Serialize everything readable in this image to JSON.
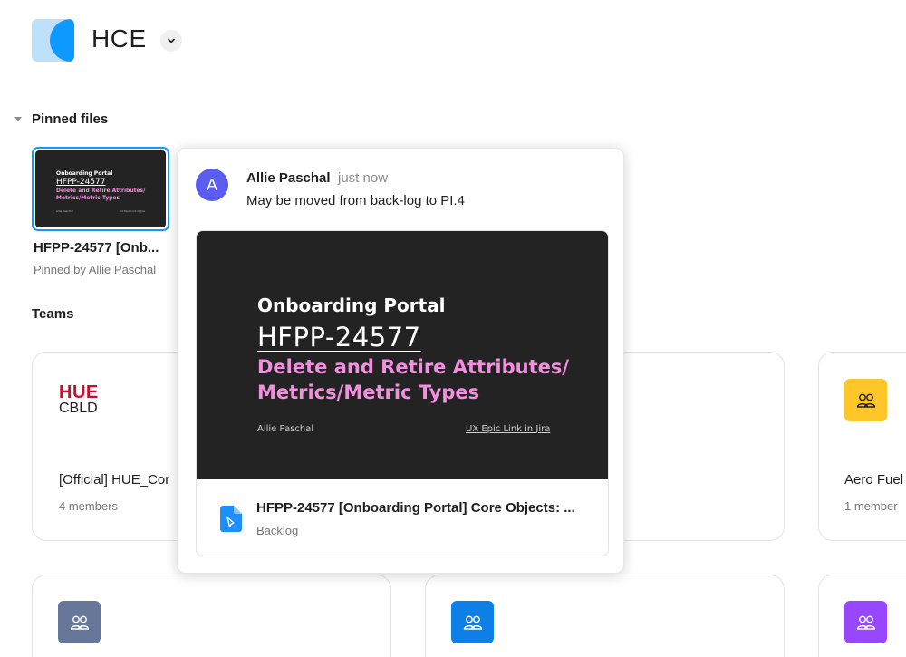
{
  "org": {
    "name": "HCE"
  },
  "pinned": {
    "section_title": "Pinned files",
    "file_name": "HFPP-24577 [Onb...",
    "pinned_by": "Pinned by Allie Paschal",
    "thumb": {
      "title": "Onboarding Portal",
      "code": "HFPP-24577",
      "subtitle": "Delete and Retire Attributes/ Metrics/Metric Types",
      "author": "Allie Paschal",
      "link": "UX Epic Link in Jira"
    }
  },
  "teams": {
    "section_title": "Teams",
    "cards": [
      {
        "logo_top": "HUE",
        "logo_bottom": "CBLD",
        "name": "[Official] HUE_Cor",
        "members": "4 members"
      },
      {
        "name": "Aero Fuel",
        "members": "1 member",
        "icon_color": "#ffc629"
      }
    ],
    "row2_icon_colors": [
      "#667799",
      "#0d7fe6",
      "#9747ff"
    ]
  },
  "popover": {
    "avatar_initial": "A",
    "author": "Allie Paschal",
    "time": "just now",
    "message": "May be moved from back-log to PI.4",
    "preview": {
      "title": "Onboarding Portal",
      "code": "HFPP-24577",
      "subtitle": "Delete and Retire Attributes/ Metrics/Metric Types",
      "author": "Allie Paschal",
      "link": "UX Epic Link in Jira"
    },
    "file_title": "HFPP-24577 [Onboarding Portal] Core Objects: ...",
    "file_project": "Backlog"
  },
  "colors": {
    "accent": "#0d99ff",
    "avatar": "#5a5dee",
    "highlight_pink": "#f28fdf"
  }
}
